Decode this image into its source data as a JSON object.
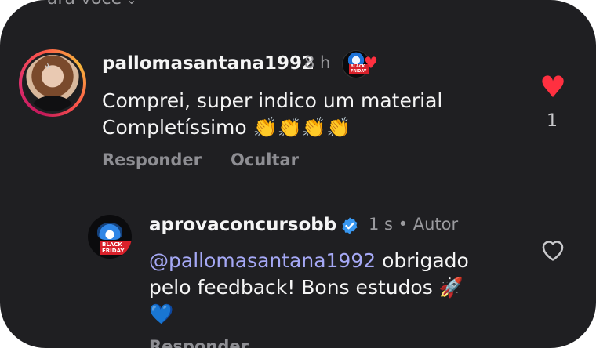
{
  "header_cut": {
    "left_text": "ara você",
    "faint_text": ""
  },
  "comment1": {
    "username": "pallomasantana1992",
    "time": "8 h",
    "text_line1": "Comprei, super indico um material",
    "text_line2": "Completíssimo",
    "emojis": "👏👏👏👏",
    "reply_label": "Responder",
    "hide_label": "Ocultar",
    "like_count": "1",
    "liked": true
  },
  "reply1": {
    "username": "aprovaconcursobb",
    "verified": true,
    "time": "1 s",
    "separator": "•",
    "author_label": "Autor",
    "mention": "@pallomasantana1992",
    "text_after_mention": " obrigado",
    "text_line2": "pelo feedback! Bons estudos",
    "rocket": "🚀",
    "heart_emoji": "💙",
    "reply_label": "Responder",
    "liked": false
  },
  "badge_text": "BLACK FRIDAY",
  "icons": {
    "like_filled": "heart-filled-icon",
    "like_outline": "heart-outline-icon",
    "verified": "verified-badge-icon",
    "chevron": "chevron-down-icon"
  },
  "colors": {
    "background": "#1f1f22",
    "like_red": "#ff3040",
    "mention": "#a5a8f5",
    "verified_blue": "#3897f0",
    "muted": "#8e8e93"
  }
}
